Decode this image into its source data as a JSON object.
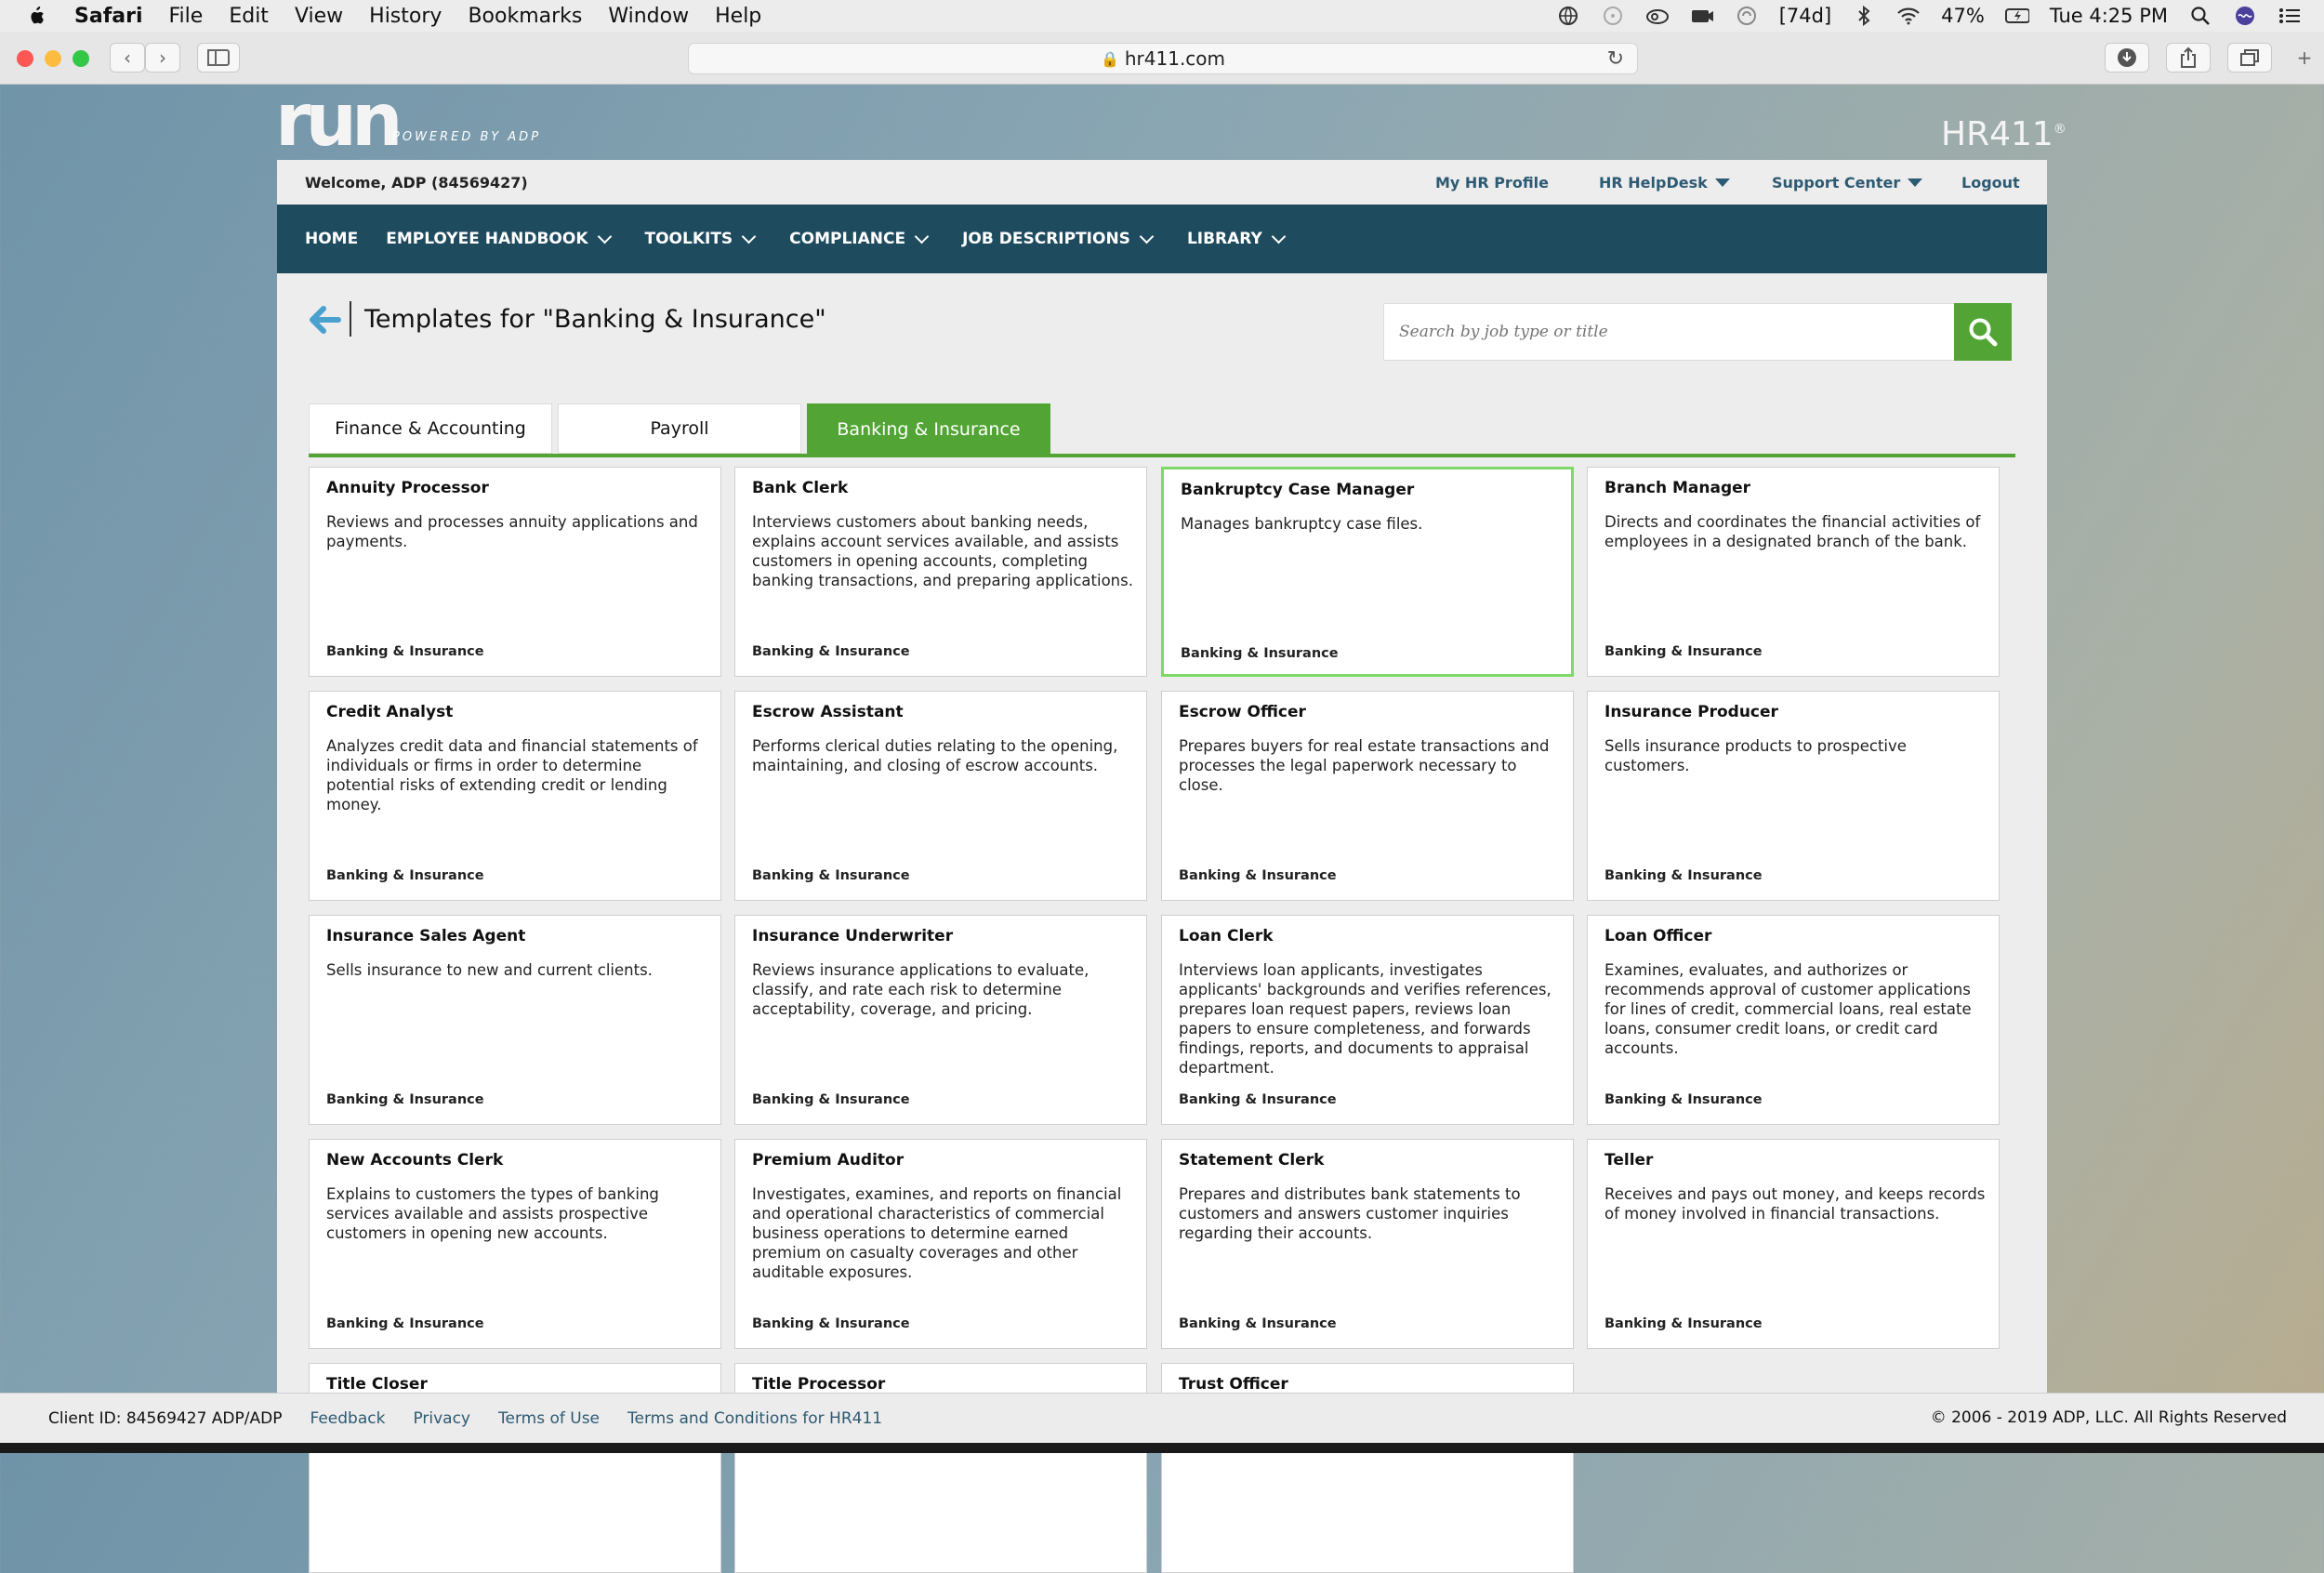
{
  "menubar": {
    "app": "Safari",
    "items": [
      "File",
      "Edit",
      "View",
      "History",
      "Bookmarks",
      "Window",
      "Help"
    ],
    "status_badge": "[74d]",
    "battery": "47%",
    "clock": "Tue 4:25 PM"
  },
  "browser": {
    "url": "hr411.com"
  },
  "site": {
    "logo_text": "run",
    "logo_sub": "POWERED BY ADP",
    "brand": "HR411"
  },
  "topbar": {
    "welcome": "Welcome, ADP (84569427)",
    "links": [
      "My HR Profile",
      "HR HelpDesk",
      "Support Center",
      "Logout"
    ]
  },
  "nav": {
    "items": [
      "HOME",
      "EMPLOYEE HANDBOOK",
      "TOOLKITS",
      "COMPLIANCE",
      "JOB DESCRIPTIONS",
      "LIBRARY"
    ]
  },
  "page": {
    "title": "Templates for \"Banking & Insurance\"",
    "search_placeholder": "Search by job type or title"
  },
  "tabs": [
    {
      "label": "Finance & Accounting",
      "active": false
    },
    {
      "label": "Payroll",
      "active": false
    },
    {
      "label": "Banking & Insurance",
      "active": true
    }
  ],
  "cards": [
    {
      "title": "Annuity Processor",
      "desc": "Reviews and processes annuity applications and payments.",
      "category": "Banking & Insurance"
    },
    {
      "title": "Bank Clerk",
      "desc": "Interviews customers about banking needs, explains account services available, and assists customers in opening accounts, completing banking transactions, and preparing applications.",
      "category": "Banking & Insurance"
    },
    {
      "title": "Bankruptcy Case Manager",
      "desc": "Manages bankruptcy case files.",
      "category": "Banking & Insurance",
      "selected": true
    },
    {
      "title": "Branch Manager",
      "desc": "Directs and coordinates the financial activities of employees in a designated branch of the bank.",
      "category": "Banking & Insurance"
    },
    {
      "title": "Credit Analyst",
      "desc": "Analyzes credit data and financial statements of individuals or firms in order to determine potential risks of extending credit or lending money.",
      "category": "Banking & Insurance"
    },
    {
      "title": "Escrow Assistant",
      "desc": "Performs clerical duties relating to the opening, maintaining, and closing of escrow accounts.",
      "category": "Banking & Insurance"
    },
    {
      "title": "Escrow Officer",
      "desc": "Prepares buyers for real estate transactions and processes the legal paperwork necessary to close.",
      "category": "Banking & Insurance"
    },
    {
      "title": "Insurance Producer",
      "desc": "Sells insurance products to prospective customers.",
      "category": "Banking & Insurance"
    },
    {
      "title": "Insurance Sales Agent",
      "desc": "Sells insurance to new and current clients.",
      "category": "Banking & Insurance"
    },
    {
      "title": "Insurance Underwriter",
      "desc": "Reviews insurance applications to evaluate, classify, and rate each risk to determine acceptability, coverage, and pricing.",
      "category": "Banking & Insurance"
    },
    {
      "title": "Loan Clerk",
      "desc": "Interviews loan applicants, investigates applicants' backgrounds and verifies references, prepares loan request papers, reviews loan papers to ensure completeness, and forwards findings, reports, and documents to appraisal department.",
      "category": "Banking & Insurance"
    },
    {
      "title": "Loan Officer",
      "desc": "Examines, evaluates, and authorizes or recommends approval of customer applications for lines of credit, commercial loans, real estate loans, consumer credit loans, or credit card accounts.",
      "category": "Banking & Insurance"
    },
    {
      "title": "New Accounts Clerk",
      "desc": "Explains to customers the types of banking services available and assists prospective customers in opening new accounts.",
      "category": "Banking & Insurance"
    },
    {
      "title": "Premium Auditor",
      "desc": "Investigates, examines, and reports on financial and operational characteristics of commercial business operations to determine earned premium on casualty coverages and other auditable exposures.",
      "category": "Banking & Insurance"
    },
    {
      "title": "Statement Clerk",
      "desc": "Prepares and distributes bank statements to customers and answers customer inquiries regarding their accounts.",
      "category": "Banking & Insurance"
    },
    {
      "title": "Teller",
      "desc": "Receives and pays out money, and keeps records of money involved in financial transactions.",
      "category": "Banking & Insurance"
    },
    {
      "title": "Title Closer",
      "desc": "",
      "category": ""
    },
    {
      "title": "Title Processor",
      "desc": "",
      "category": ""
    },
    {
      "title": "Trust Officer",
      "desc": "",
      "category": ""
    }
  ],
  "footer": {
    "client_id": "Client ID: 84569427 ADP/ADP",
    "links": [
      "Feedback",
      "Privacy",
      "Terms of Use",
      "Terms and Conditions for HR411"
    ],
    "copyright": "© 2006 - 2019 ADP, LLC. All Rights Reserved"
  },
  "colors": {
    "nav_bg": "#1f4b5f",
    "accent_green": "#52a535",
    "link_blue": "#2d5a73"
  }
}
